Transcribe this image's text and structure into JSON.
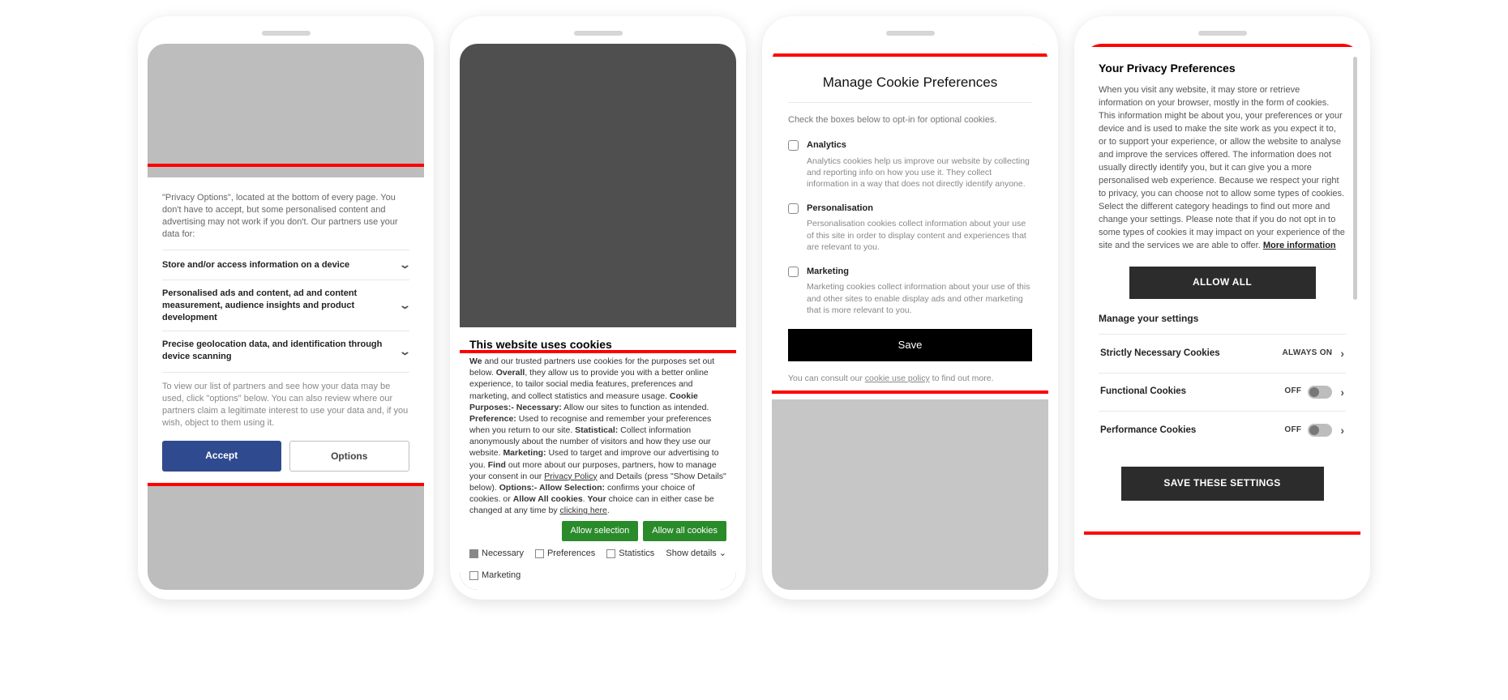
{
  "phone1": {
    "intro": "\"Privacy Options\", located at the bottom of every page. You don't have to accept, but some personalised content and advertising may not work if you don't. Our partners use your data for:",
    "purposes": [
      "Store and/or access information on a device",
      "Personalised ads and content, ad and content measurement, audience insights and product development",
      "Precise geolocation data, and identification through device scanning"
    ],
    "footer": "To view our list of partners and see how your data may be used, click \"options\" below. You can also review where our partners claim a legitimate interest to use your data and, if you wish, object to them using it.",
    "accept": "Accept",
    "options": "Options"
  },
  "phone2": {
    "title": "This website uses cookies",
    "body_parts": {
      "t1a": "We",
      "t1b": " and our trusted partners use cookies for the purposes set out below. ",
      "t2a": "Overall",
      "t2b": ", they allow us to provide you with a better online experience, to tailor social media features, preferences and marketing, and collect statistics and measure usage. ",
      "t3a": "Cookie Purposes:- Necessary:",
      "t3b": " Allow our sites to function as intended. ",
      "t4a": "Preference:",
      "t4b": " Used to recognise and remember your preferences when you return to our site. ",
      "t5a": "Statistical:",
      "t5b": " Collect information anonymously about the number of visitors and how they use our website. ",
      "t6a": "Marketing:",
      "t6b": " Used to target and improve our advertising to you. ",
      "t7a": "Find",
      "t7b": " out more about our purposes, partners, how to manage your consent in our ",
      "t7link": "Privacy Policy",
      "t8": " and Details (press \"Show Details\" below). ",
      "t9a": "Options:- Allow Selection:",
      "t9b": " confirms your choice of cookies. or ",
      "t10a": "Allow All cookies",
      "t10b": ". ",
      "t11a": "Your",
      "t11b": " choice can in either case be changed at any time by ",
      "t11link": "clicking here",
      "t11c": "."
    },
    "allow_selection": "Allow selection",
    "allow_all": "Allow all cookies",
    "checks": {
      "necessary": "Necessary",
      "preferences": "Preferences",
      "statistics": "Statistics",
      "marketing": "Marketing"
    },
    "show_details": "Show details"
  },
  "phone3": {
    "title": "Manage Cookie Preferences",
    "intro": "Check the boxes below to opt-in for optional cookies.",
    "cats": [
      {
        "name": "Analytics",
        "desc": "Analytics cookies help us improve our website by collecting and reporting info on how you use it. They collect information in a way that does not directly identify anyone."
      },
      {
        "name": "Personalisation",
        "desc": "Personalisation cookies collect information about your use of this site in order to display content and experiences that are relevant to you."
      },
      {
        "name": "Marketing",
        "desc": "Marketing cookies collect information about your use of this and other sites to enable display ads and other marketing that is more relevant to you."
      }
    ],
    "save": "Save",
    "foot1": "You can consult our ",
    "foot_link": "cookie use policy",
    "foot2": " to find out more."
  },
  "phone4": {
    "title": "Your Privacy Preferences",
    "text": "When you visit any website, it may store or retrieve information on your browser, mostly in the form of cookies. This information might be about you, your preferences or your device and is used to make the site work as you expect it to, or to support your experience, or allow the website to analyse and improve the services offered. The information does not usually directly identify you, but it can give you a more personalised web experience. Because we respect your right to privacy, you can choose not to allow some types of cookies. Select the different category headings to find out more and change your settings. Please note that if you do not opt in to some types of cookies it may impact on your experience of the site and the services we are able to offer.  ",
    "more": "More information",
    "allow_all": "ALLOW ALL",
    "manage": "Manage your settings",
    "rows": [
      {
        "name": "Strictly Necessary Cookies",
        "state": "ALWAYS ON",
        "toggle": false
      },
      {
        "name": "Functional Cookies",
        "state": "OFF",
        "toggle": true
      },
      {
        "name": "Performance Cookies",
        "state": "OFF",
        "toggle": true
      }
    ],
    "save": "SAVE THESE SETTINGS"
  }
}
